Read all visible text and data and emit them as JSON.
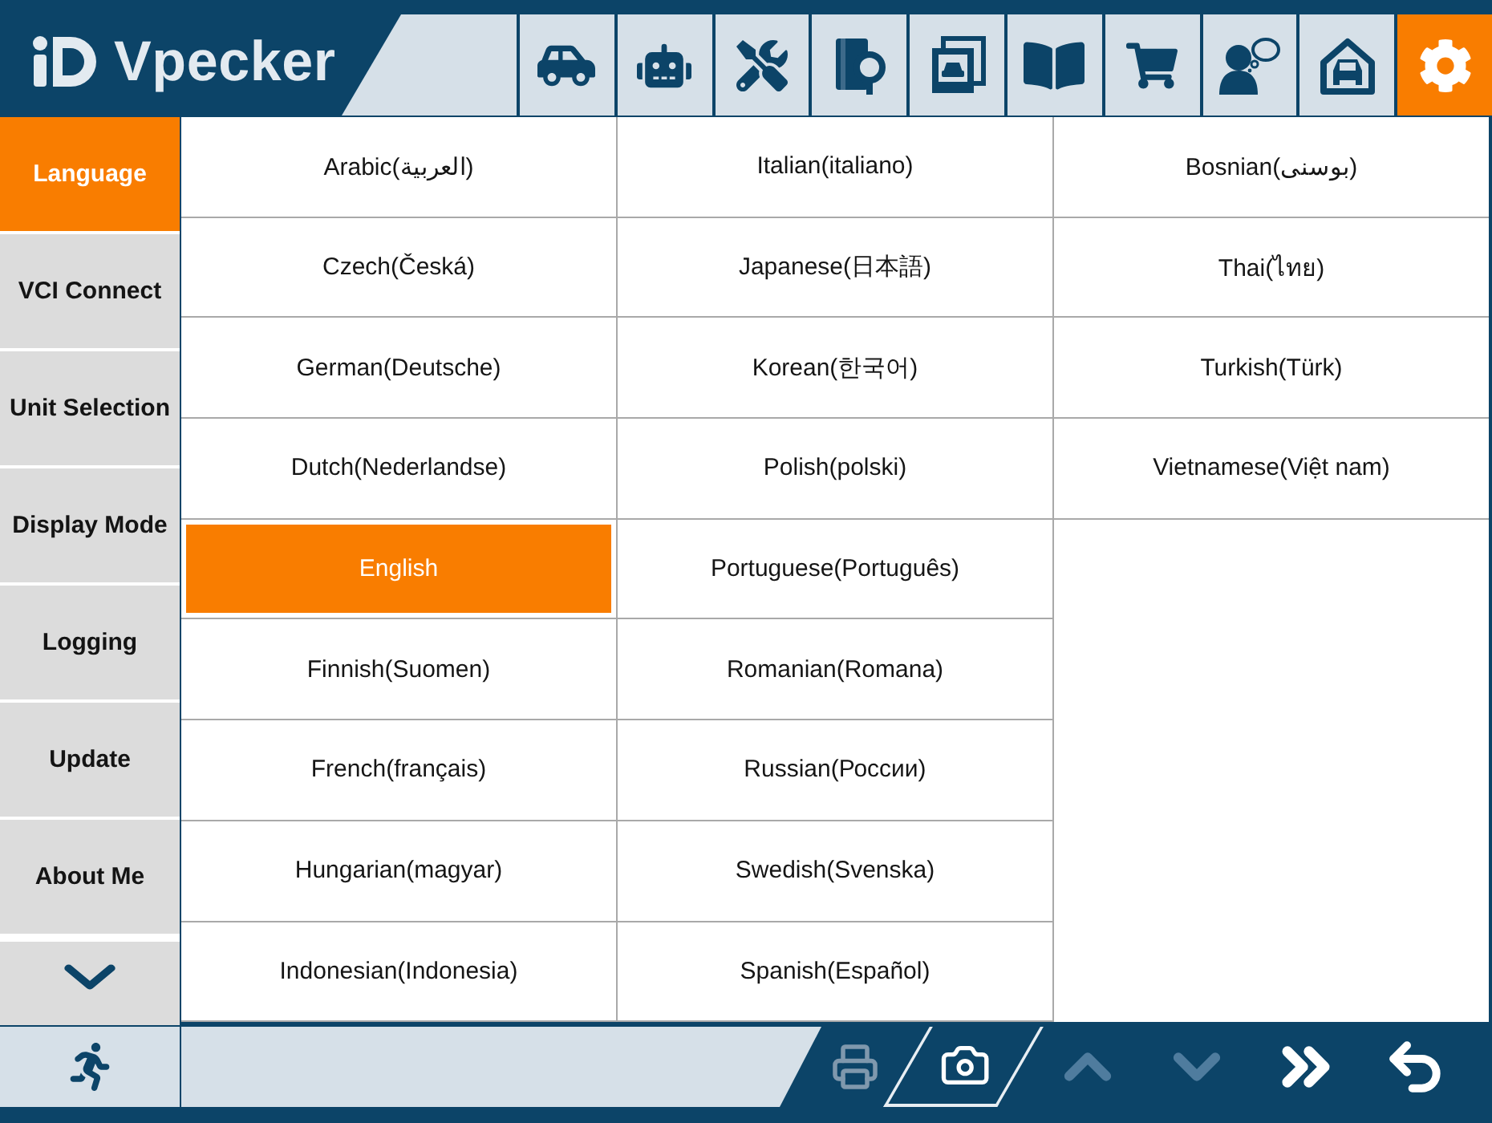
{
  "header": {
    "logo": "Vpecker",
    "tools": [
      {
        "kind": "car",
        "selected": false
      },
      {
        "kind": "robot",
        "selected": false
      },
      {
        "kind": "tools",
        "selected": false
      },
      {
        "kind": "manual",
        "selected": false
      },
      {
        "kind": "gallery",
        "selected": false
      },
      {
        "kind": "book",
        "selected": false
      },
      {
        "kind": "shop",
        "selected": false
      },
      {
        "kind": "feedback",
        "selected": false
      },
      {
        "kind": "garage",
        "selected": false
      },
      {
        "kind": "settings",
        "selected": true
      }
    ]
  },
  "sidebar": {
    "items": [
      {
        "label": "Language",
        "selected": true
      },
      {
        "label": "VCI Connect",
        "selected": false
      },
      {
        "label": "Unit Selection",
        "selected": false
      },
      {
        "label": "Display Mode",
        "selected": false
      },
      {
        "label": "Logging",
        "selected": false
      },
      {
        "label": "Update",
        "selected": false
      },
      {
        "label": "About Me",
        "selected": false
      }
    ]
  },
  "languages": {
    "columns": [
      {
        "items": [
          {
            "label": "Arabic(العربية)",
            "selected": false
          },
          {
            "label": "Czech(Česká)",
            "selected": false
          },
          {
            "label": "German(Deutsche)",
            "selected": false
          },
          {
            "label": "Dutch(Nederlandse)",
            "selected": false
          },
          {
            "label": "English",
            "selected": true
          },
          {
            "label": "Finnish(Suomen)",
            "selected": false
          },
          {
            "label": "French(français)",
            "selected": false
          },
          {
            "label": "Hungarian(magyar)",
            "selected": false
          },
          {
            "label": "Indonesian(Indonesia)",
            "selected": false
          }
        ]
      },
      {
        "items": [
          {
            "label": "Italian(italiano)",
            "selected": false
          },
          {
            "label": "Japanese(日本語)",
            "selected": false
          },
          {
            "label": "Korean(한국어)",
            "selected": false
          },
          {
            "label": "Polish(polski)",
            "selected": false
          },
          {
            "label": "Portuguese(Português)",
            "selected": false
          },
          {
            "label": "Romanian(Romana)",
            "selected": false
          },
          {
            "label": "Russian(России)",
            "selected": false
          },
          {
            "label": "Swedish(Svenska)",
            "selected": false
          },
          {
            "label": "Spanish(Español)",
            "selected": false
          }
        ]
      },
      {
        "items": [
          {
            "label": "Bosnian(بوسنى)",
            "selected": false
          },
          {
            "label": "Thai(ไทย)",
            "selected": false
          },
          {
            "label": "Turkish(Türk)",
            "selected": false
          },
          {
            "label": "Vietnamese(Việt nam)",
            "selected": false
          }
        ]
      }
    ]
  },
  "bottom_bar": {
    "buttons": [
      {
        "kind": "exit",
        "disabled": false
      },
      {
        "kind": "print",
        "disabled": true
      },
      {
        "kind": "camera",
        "disabled": false
      },
      {
        "kind": "up",
        "disabled": true
      },
      {
        "kind": "down",
        "disabled": true
      },
      {
        "kind": "next",
        "disabled": false
      },
      {
        "kind": "back",
        "disabled": false
      }
    ]
  }
}
